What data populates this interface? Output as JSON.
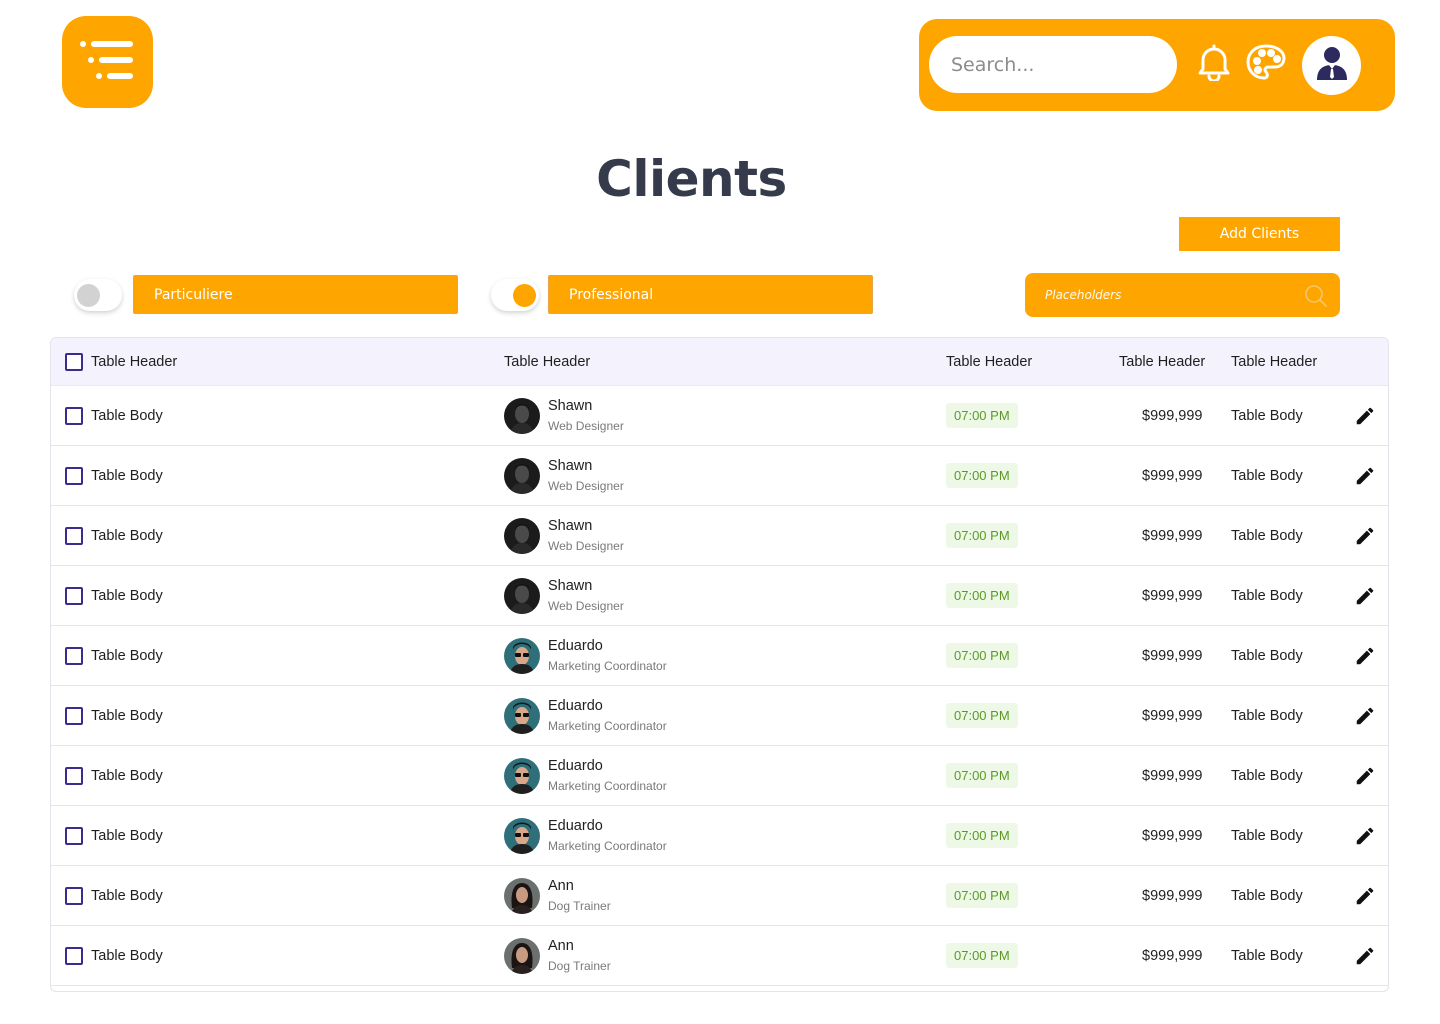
{
  "header": {
    "menu_icon": "list-menu-icon",
    "search_placeholder": "Search...",
    "notification_icon": "bell-icon",
    "theme_icon": "palette-icon",
    "profile_icon": "user-avatar-icon"
  },
  "page": {
    "title": "Clients",
    "add_button": "Add Clients"
  },
  "filters": {
    "particuliere": {
      "label": "Particuliere",
      "enabled": false
    },
    "professional": {
      "label": "Professional",
      "enabled": true
    },
    "search_placeholder": "Placeholders"
  },
  "colors": {
    "accent": "#FFA500",
    "title": "#353B4A",
    "header_bg": "#F4F2FD",
    "checkbox": "#3E2A8F",
    "badge_bg": "#EDF9E6",
    "badge_text": "#5A9A24"
  },
  "table": {
    "headers": [
      "Table Header",
      "Table Header",
      "Table Header",
      "Table Header",
      "Table Header"
    ],
    "rows": [
      {
        "label": "Table Body",
        "name": "Shawn",
        "role": "Web Designer",
        "time": "07:00 PM",
        "amount": "$999,999",
        "extra": "Table Body"
      },
      {
        "label": "Table Body",
        "name": "Shawn",
        "role": "Web Designer",
        "time": "07:00 PM",
        "amount": "$999,999",
        "extra": "Table Body"
      },
      {
        "label": "Table Body",
        "name": "Shawn",
        "role": "Web Designer",
        "time": "07:00 PM",
        "amount": "$999,999",
        "extra": "Table Body"
      },
      {
        "label": "Table Body",
        "name": "Shawn",
        "role": "Web Designer",
        "time": "07:00 PM",
        "amount": "$999,999",
        "extra": "Table Body"
      },
      {
        "label": "Table Body",
        "name": "Eduardo",
        "role": "Marketing Coordinator",
        "time": "07:00 PM",
        "amount": "$999,999",
        "extra": "Table Body"
      },
      {
        "label": "Table Body",
        "name": "Eduardo",
        "role": "Marketing Coordinator",
        "time": "07:00 PM",
        "amount": "$999,999",
        "extra": "Table Body"
      },
      {
        "label": "Table Body",
        "name": "Eduardo",
        "role": "Marketing Coordinator",
        "time": "07:00 PM",
        "amount": "$999,999",
        "extra": "Table Body"
      },
      {
        "label": "Table Body",
        "name": "Eduardo",
        "role": "Marketing Coordinator",
        "time": "07:00 PM",
        "amount": "$999,999",
        "extra": "Table Body"
      },
      {
        "label": "Table Body",
        "name": "Ann",
        "role": "Dog Trainer",
        "time": "07:00 PM",
        "amount": "$999,999",
        "extra": "Table Body"
      },
      {
        "label": "Table Body",
        "name": "Ann",
        "role": "Dog Trainer",
        "time": "07:00 PM",
        "amount": "$999,999",
        "extra": "Table Body"
      }
    ]
  }
}
